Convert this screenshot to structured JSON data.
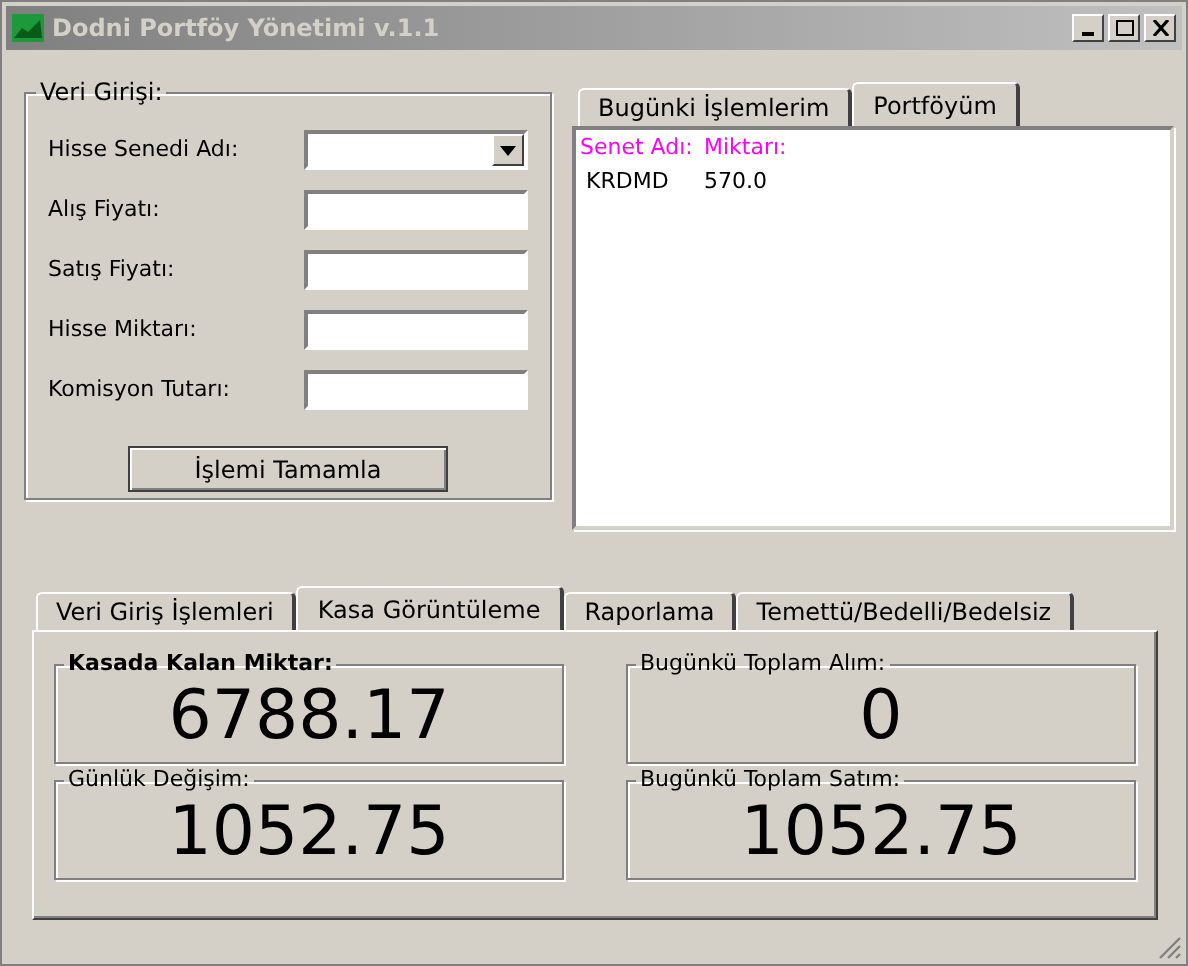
{
  "window": {
    "title": "Dodni Portföy Yönetimi v.1.1"
  },
  "entry_group": {
    "title": "Veri Girişi:",
    "fields": [
      {
        "label": "Hisse Senedi Adı:",
        "kind": "dropdown"
      },
      {
        "label": "Alış Fiyatı:",
        "kind": "text"
      },
      {
        "label": "Satış Fiyatı:",
        "kind": "text"
      },
      {
        "label": "Hisse Miktarı:",
        "kind": "text"
      },
      {
        "label": "Komisyon Tutarı:",
        "kind": "text"
      }
    ],
    "submit_button": "İşlemi Tamamla"
  },
  "right_tabs": [
    {
      "label": "Bugünki İşlemlerim",
      "selected": false
    },
    {
      "label": "Portföyüm",
      "selected": true
    }
  ],
  "portfolio": {
    "columns": [
      "Senet Adı:",
      "Miktarı:"
    ],
    "rows": [
      [
        "KRDMD",
        "570.0"
      ]
    ]
  },
  "bottom_tabs": [
    {
      "label": "Veri Giriş İşlemleri",
      "selected": false
    },
    {
      "label": "Kasa Görüntüleme",
      "selected": true
    },
    {
      "label": "Raporlama",
      "selected": false
    },
    {
      "label": "Temettü/Bedelli/Bedelsiz",
      "selected": false
    }
  ],
  "cash_boxes": [
    {
      "title": "Kasada Kalan Miktar:",
      "value": "6788.17",
      "bold": true
    },
    {
      "title": "Bugünkü Toplam Alım:",
      "value": "0",
      "bold": false
    },
    {
      "title": "Günlük Değişim:",
      "value": "1052.75",
      "bold": false
    },
    {
      "title": "Bugünkü Toplam Satım:",
      "value": "1052.75",
      "bold": false
    }
  ]
}
